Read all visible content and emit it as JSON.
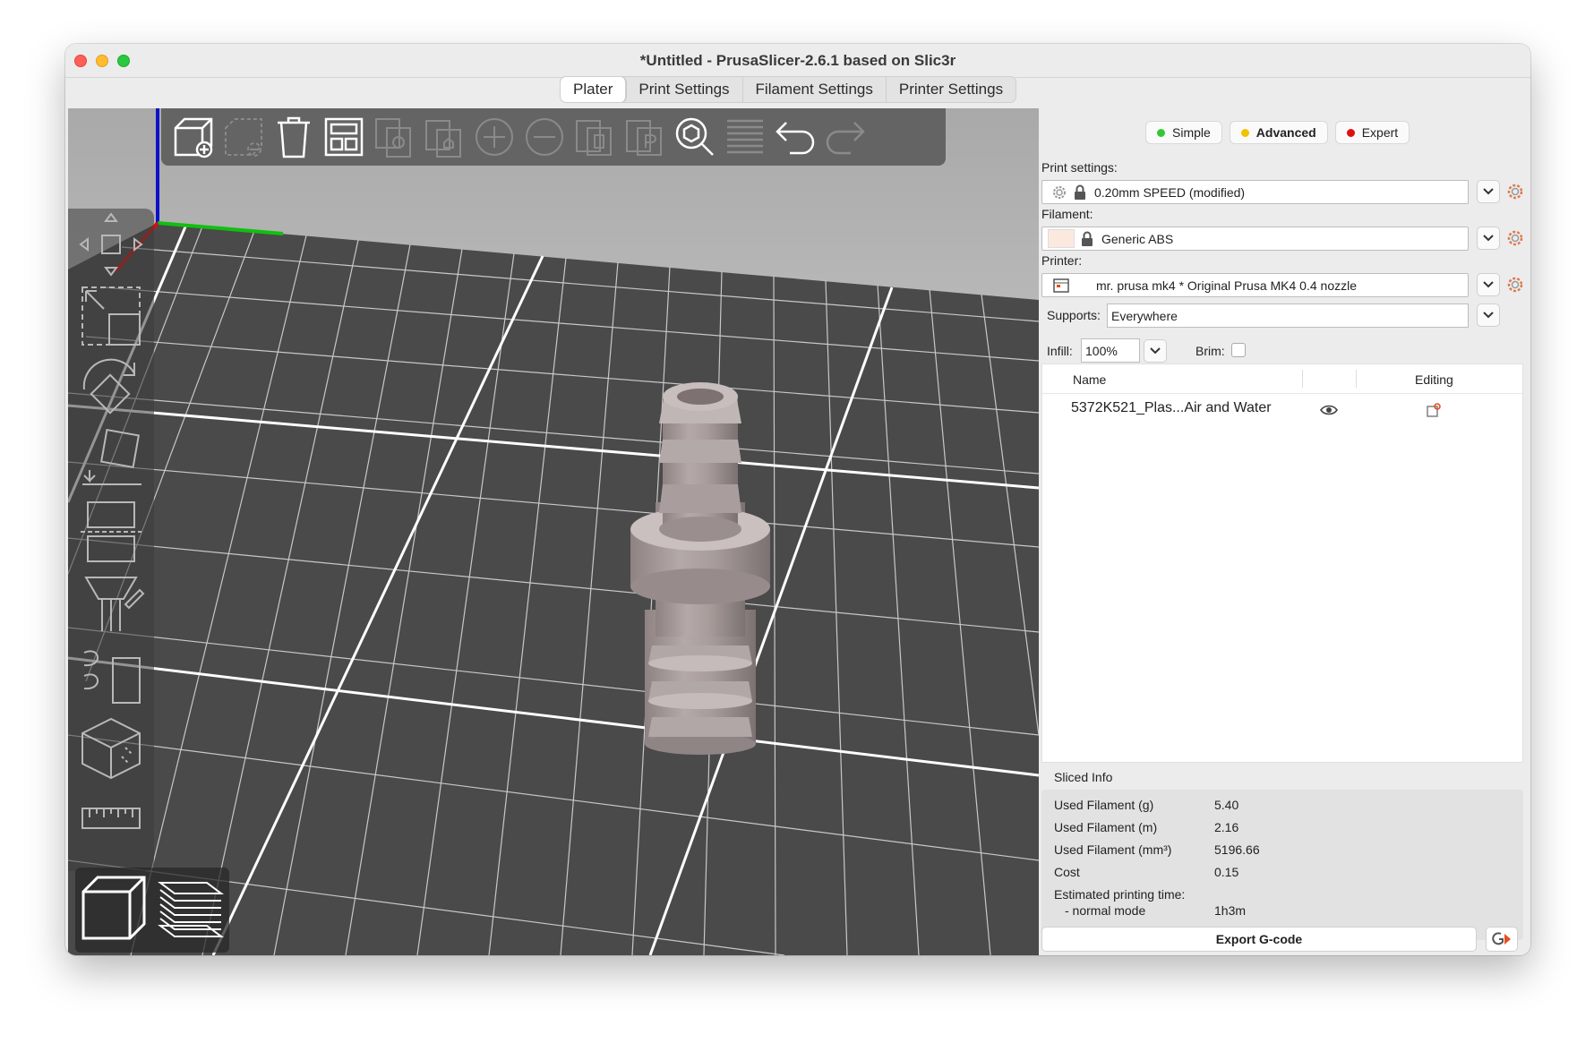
{
  "window": {
    "title": "*Untitled - PrusaSlicer-2.6.1 based on Slic3r"
  },
  "tabs": [
    {
      "label": "Plater",
      "active": true
    },
    {
      "label": "Print Settings"
    },
    {
      "label": "Filament Settings"
    },
    {
      "label": "Printer Settings"
    }
  ],
  "top_toolbar": {
    "icons": [
      "add-object-icon",
      "delete-icon",
      "delete-all-icon",
      "arrange-icon",
      "copy-icon",
      "paste-icon",
      "add-instance-icon",
      "remove-instance-icon",
      "split-objects-icon",
      "split-parts-icon",
      "search-icon",
      "layers-editing-icon",
      "undo-icon",
      "redo-icon"
    ]
  },
  "side_toolbar": {
    "icons": [
      "move-icon",
      "scale-icon",
      "rotate-icon",
      "place-on-face-icon",
      "cut-icon",
      "paint-supports-icon",
      "seam-painting-icon",
      "measure-icon"
    ]
  },
  "view_toggle": {
    "icons": [
      "3d-view-icon",
      "preview-icon"
    ]
  },
  "modes": [
    {
      "label": "Simple",
      "color": "#35c735"
    },
    {
      "label": "Advanced",
      "color": "#f2c200",
      "selected": true
    },
    {
      "label": "Expert",
      "color": "#e01010"
    }
  ],
  "print_settings": {
    "label": "Print settings:",
    "value": "0.20mm SPEED (modified)"
  },
  "filament": {
    "label": "Filament:",
    "value": "Generic ABS",
    "swatch_color": "#fbe9e0"
  },
  "printer": {
    "label": "Printer:",
    "value": "mr. prusa mk4 * Original Prusa MK4 0.4 nozzle"
  },
  "supports": {
    "label": "Supports:",
    "value": "Everywhere"
  },
  "infill": {
    "label": "Infill:",
    "value": "100%"
  },
  "brim": {
    "label": "Brim:",
    "checked": false
  },
  "object_list": {
    "columns": {
      "name": "Name",
      "editing": "Editing"
    },
    "rows": [
      {
        "name": "5372K521_Plas...Air and Water"
      }
    ]
  },
  "sliced_info": {
    "title": "Sliced Info",
    "rows": [
      {
        "label": "Used Filament (g)",
        "value": "5.40"
      },
      {
        "label": "Used Filament (m)",
        "value": "2.16"
      },
      {
        "label": "Used Filament (mm³)",
        "value": "5196.66"
      },
      {
        "label": "Cost",
        "value": "0.15"
      },
      {
        "label": "Estimated printing time:",
        "value": ""
      },
      {
        "label": "- normal mode",
        "value": "1h3m"
      }
    ]
  },
  "export": {
    "label": "Export G-code"
  }
}
